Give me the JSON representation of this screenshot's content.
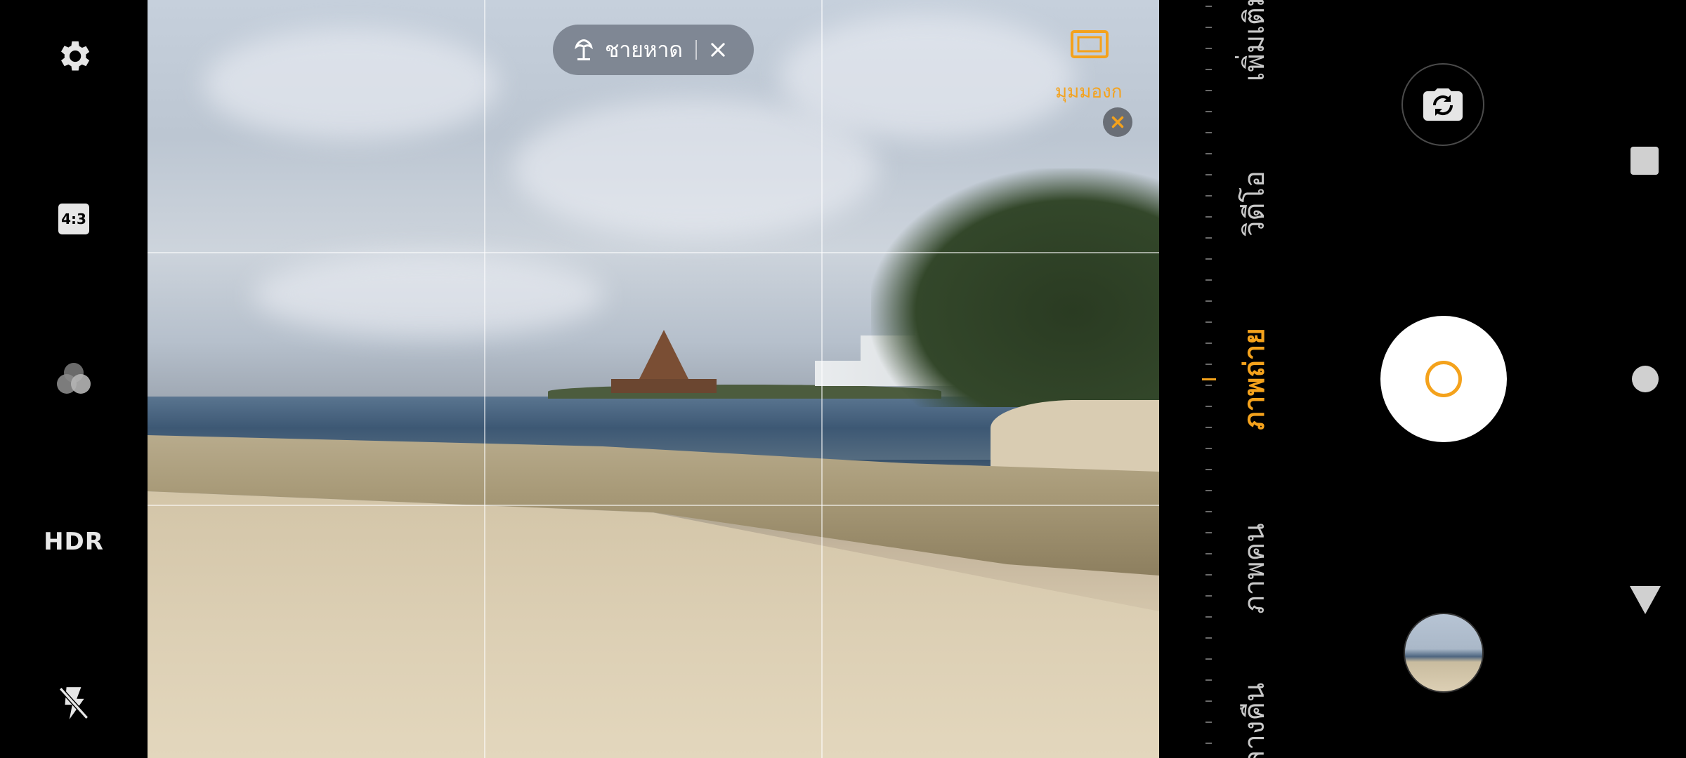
{
  "left_toolbar": {
    "aspect_ratio": "4:3",
    "hdr_label": "HDR",
    "icons": [
      "settings-gear-icon",
      "aspect-ratio-icon",
      "color-filter-icon",
      "hdr-icon",
      "flash-off-icon"
    ]
  },
  "viewfinder": {
    "scene_detection": {
      "label": "ชายหาด",
      "icon": "scene-beach-icon",
      "close_icon": "close-icon"
    },
    "focus_mode": {
      "label": "มุมมองก",
      "icon": "frame-focus-icon",
      "close_icon": "close-icon"
    },
    "grid": "rule-of-thirds"
  },
  "modes": [
    {
      "label": "เพิ่มเติม",
      "active": false
    },
    {
      "label": "วิดีโอ",
      "active": false
    },
    {
      "label": "ภาพถ่าย",
      "active": true
    },
    {
      "label": "ภาพคน",
      "active": false
    },
    {
      "label": "กลางคืน",
      "active": false
    }
  ],
  "controls": {
    "switch_camera_icon": "camera-switch-icon",
    "shutter_icon": "shutter-button",
    "gallery_thumbnail": "last-photo-thumbnail"
  },
  "system_nav": [
    "recent-apps-square",
    "home-circle",
    "back-triangle"
  ],
  "colors": {
    "accent": "#f4a21c",
    "background": "#000000",
    "text": "#c9c9c9"
  }
}
